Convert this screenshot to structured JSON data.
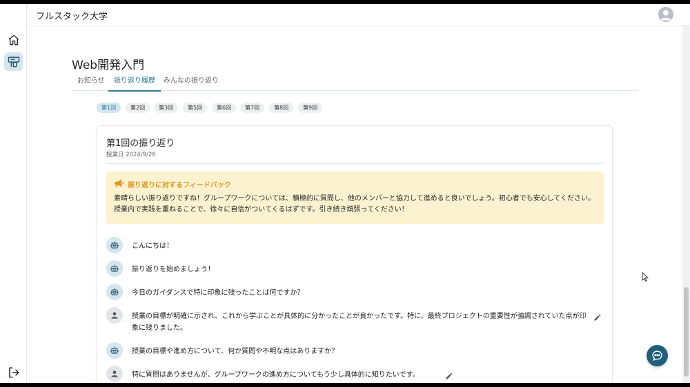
{
  "header": {
    "app_title": "フルスタック大学"
  },
  "course": {
    "title": "Web開発入門"
  },
  "tabs": [
    {
      "label": "お知らせ",
      "active": false
    },
    {
      "label": "振り返り履歴",
      "active": true
    },
    {
      "label": "みんなの振り返り",
      "active": false
    }
  ],
  "sessions": [
    {
      "label": "第1回",
      "active": true
    },
    {
      "label": "第2回",
      "active": false
    },
    {
      "label": "第3回",
      "active": false
    },
    {
      "label": "第5回",
      "active": false
    },
    {
      "label": "第6回",
      "active": false
    },
    {
      "label": "第7回",
      "active": false
    },
    {
      "label": "第8回",
      "active": false
    },
    {
      "label": "第9回",
      "active": false
    }
  ],
  "card": {
    "title": "第1回の振り返り",
    "date": "授業日 2024/9/26",
    "feedback": {
      "title": "振り返りに対するフィードバック",
      "body": "素晴らしい振り返りですね！グループワークについては、積極的に質問し、他のメンバーと協力して進めると良いでしょう。初心者でも安心してください。授業内で実践を重ねることで、徐々に自信がついてくるはずです。引き続き頑張ってください！"
    },
    "messages": [
      {
        "role": "bot",
        "text": "こんにちは！"
      },
      {
        "role": "bot",
        "text": "振り返りを始めましょう！"
      },
      {
        "role": "bot",
        "text": "今日のガイダンスで特に印象に残ったことは何ですか？"
      },
      {
        "role": "user",
        "text": "授業の目標が明確に示され、これから学ぶことが具体的に分かったことが良かったです。特に、最終プロジェクトの重要性が強調されていた点が印象に残りました。"
      },
      {
        "role": "bot",
        "text": "授業の目標や進め方について、何か質問や不明な点はありますか？"
      },
      {
        "role": "user",
        "text": "特に質問はありませんが、グループワークの進め方についてもう少し具体的に知りたいです。"
      }
    ]
  },
  "colors": {
    "accent": "#2a7a98",
    "active_bg": "#d4e6ef",
    "feedback_bg": "#fdf2d0",
    "feedback_title": "#e0951a",
    "fab": "#1f5f7a"
  },
  "icons": {
    "sidebar": [
      "home-icon",
      "reflection-icon",
      "logout-icon"
    ],
    "header": "avatar-icon",
    "feedback": "megaphone-icon",
    "bot": "robot-icon",
    "user": "person-icon",
    "edit": "pencil-icon",
    "fab": "chat-icon"
  }
}
